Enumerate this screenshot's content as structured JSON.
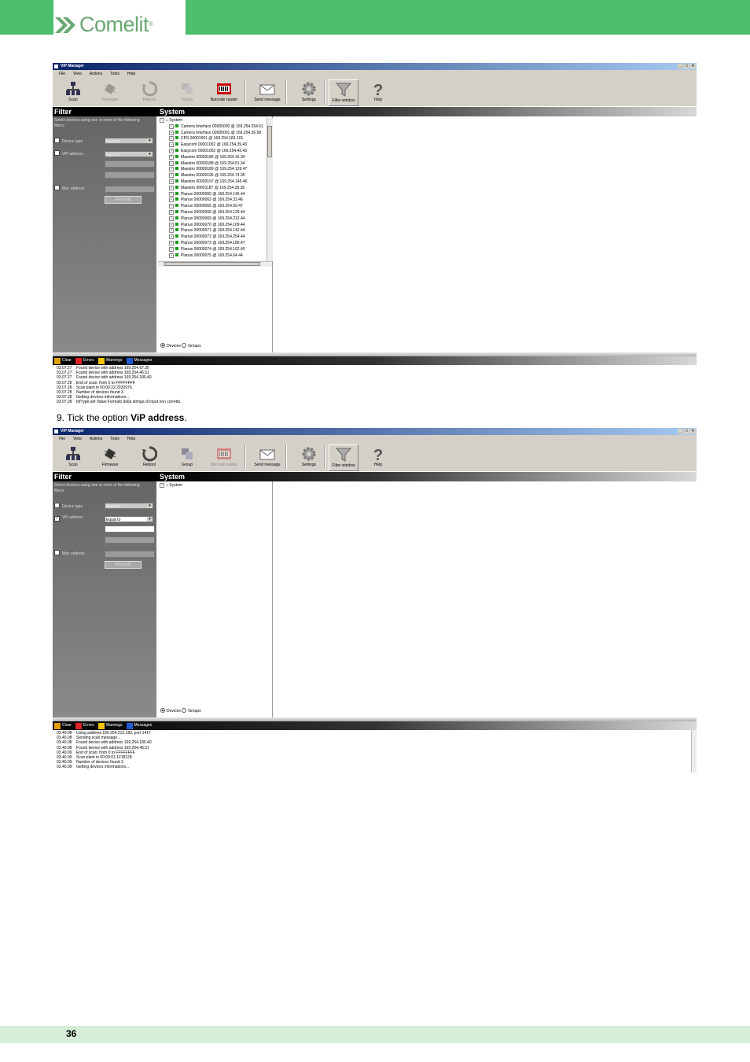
{
  "brand": {
    "name": "Comelit",
    "reg": "®"
  },
  "page_number": "36",
  "step_prefix": "9. Tick the option ",
  "step_bold": "ViP address",
  "step_suffix": ".",
  "colors": {
    "header_green": "#4cbe6c",
    "footer_green": "#d6edd8",
    "tree_device": "#1a9a1a"
  },
  "window1": {
    "title": "ViP Manager",
    "menu": [
      "File",
      "View",
      "Actions",
      "Tools",
      "Help"
    ],
    "toolbar": [
      {
        "label": "Scan",
        "icon": "network-icon",
        "enabled": true
      },
      {
        "label": "Firmware",
        "icon": "chip-icon",
        "enabled": false
      },
      {
        "label": "Reboot",
        "icon": "reboot-icon",
        "enabled": false
      },
      {
        "label": "Group",
        "icon": "group-icon",
        "enabled": false
      },
      {
        "label": "Barcode reader",
        "icon": "barcode-icon",
        "enabled": true
      },
      {
        "label": "Send message",
        "icon": "envelope-icon",
        "enabled": true
      },
      {
        "label": "Settings",
        "icon": "gear-icon",
        "enabled": true
      },
      {
        "label": "Filter window",
        "icon": "funnel-icon",
        "enabled": true
      },
      {
        "label": "Help",
        "icon": "question-icon",
        "enabled": true
      }
    ],
    "filter_title": "Filter",
    "filter_intro": "Select devices using one or more of the following filters:",
    "device_type_label": "Device type",
    "device_type_value": "Maestro",
    "vip_address_label": "ViP address",
    "vip_address_value": "Equal to",
    "vip_checked": false,
    "mac_address_label": "Mac address",
    "reset_button": "Reset all",
    "system_title": "System",
    "tree_root": "System",
    "tree_items": [
      "Camera Interface 00005000 @ 169.254.254.51",
      "Camera Interface 00005001 @ 169.254.36.58",
      "CPS 00001001 @ 169.254.181.101",
      "Easycom 00001002 @ 169.254.39.43",
      "Easycom 00001002 @ 169.254.43.43",
      "Maestro 00000186 @ 169.254.16.34",
      "Maestro 00000188 @ 169.254.51.34",
      "Maestro 00000189 @ 169.254.139.47",
      "Maestro 00000195 @ 169.254.74.35",
      "Maestro 00000197 @ 169.254.145.46",
      "Maestro 00001187 @ 169.254.28.36",
      "Planux 00000060 @ 169.254.145.44",
      "Planux 00000063 @ 169.254.33.46",
      "Planux 00000065 @ 169.254.60.47",
      "Planux 00000068 @ 169.254.129.44",
      "Planux 00000069 @ 169.254.212.44",
      "Planux 00000070 @ 169.254.109.44",
      "Planux 00000071 @ 169.254.142.44",
      "Planux 00000072 @ 169.254.254.44",
      "Planux 00000073 @ 169.254.186.47",
      "Planux 00000074 @ 169.254.162.45",
      "Planux 00000075 @ 169.254.64.44"
    ],
    "radio_devices": "Devices",
    "radio_groups": "Groups",
    "log_tabs": [
      "Clear",
      "Errors",
      "Warnings",
      "Messages"
    ],
    "log": [
      {
        "t": "03.07.27",
        "m": "Found device with address 169.254.67.35"
      },
      {
        "t": "03.07.27",
        "m": "Found device with address 169.254.46.51"
      },
      {
        "t": "03.07.27",
        "m": "Found device with address 169.254.180.40"
      },
      {
        "t": "03.07.28",
        "m": "End of scan: from 0 to FFFFFFFF."
      },
      {
        "t": "03.07.28",
        "m": "Scan plant in 00:00:22.2932976."
      },
      {
        "t": "03.07.28",
        "m": "Number of devices found 3."
      },
      {
        "t": "03.07.28",
        "m": "Getting devices informations..."
      },
      {
        "t": "03.07.28",
        "m": "InfType.set Value:Formato della stringa di input non corretto."
      }
    ]
  },
  "window2": {
    "title": "ViP Manager",
    "menu": [
      "File",
      "View",
      "Actions",
      "Tools",
      "Help"
    ],
    "toolbar": [
      {
        "label": "Scan",
        "icon": "network-icon",
        "enabled": true
      },
      {
        "label": "Firmware",
        "icon": "chip-icon",
        "enabled": true
      },
      {
        "label": "Reboot",
        "icon": "reboot-icon",
        "enabled": true
      },
      {
        "label": "Group",
        "icon": "group-icon",
        "enabled": true
      },
      {
        "label": "Barcode reader",
        "icon": "barcode-icon",
        "enabled": false
      },
      {
        "label": "Send message",
        "icon": "envelope-icon",
        "enabled": true
      },
      {
        "label": "Settings",
        "icon": "gear-icon",
        "enabled": true
      },
      {
        "label": "Filter window",
        "icon": "funnel-icon",
        "enabled": true
      },
      {
        "label": "Help",
        "icon": "question-icon",
        "enabled": true
      }
    ],
    "filter_title": "Filter",
    "filter_intro": "Select devices using one or more of the following filters:",
    "device_type_label": "Device type",
    "device_type_value": "Maestro",
    "vip_address_label": "ViP address",
    "vip_address_value": "Equal to",
    "vip_checked": true,
    "mac_address_label": "Mac address",
    "reset_button": "Reset all",
    "system_title": "System",
    "tree_root": "System",
    "radio_devices": "Devices",
    "radio_groups": "Groups",
    "log_tabs": [
      "Clear",
      "Errors",
      "Warnings",
      "Messages"
    ],
    "log": [
      {
        "t": "03.40.08",
        "m": "Using address 169.254.212.180, port 1417"
      },
      {
        "t": "03.40.08",
        "m": "Sending scan message..."
      },
      {
        "t": "03.40.08",
        "m": "Found device with address 169.254.180.40"
      },
      {
        "t": "03.40.08",
        "m": "Found device with address 169.254.46.51"
      },
      {
        "t": "03.40.09",
        "m": "End of scan: from 0 to FFFFFFFF."
      },
      {
        "t": "03.40.09",
        "m": "Scan plant in 00:00:01.1218128"
      },
      {
        "t": "03.40.09",
        "m": "Number of devices found 2."
      },
      {
        "t": "03.40.09",
        "m": "Getting devices informations..."
      }
    ]
  }
}
